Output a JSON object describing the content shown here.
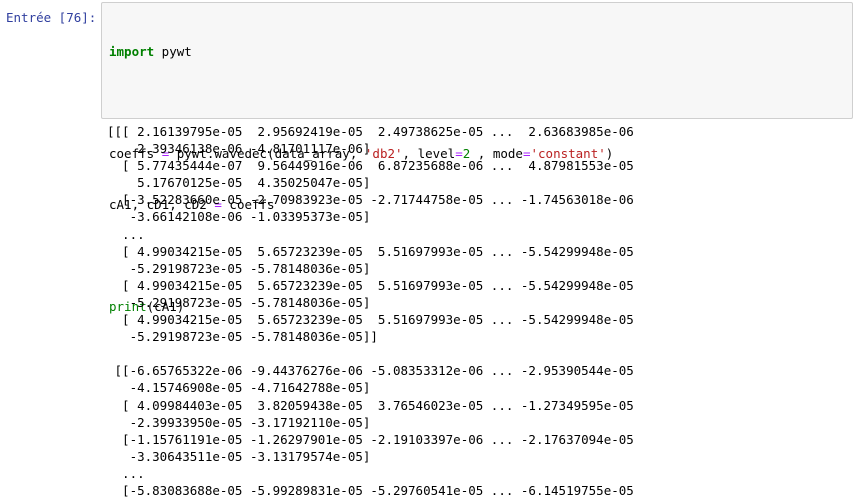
{
  "cell": {
    "prompt": "Entrée [76]:"
  },
  "code": {
    "line1": {
      "kw": "import",
      "rest": " pywt"
    },
    "line3": {
      "a": "coeffs ",
      "eq": "=",
      "b": " pywt.wavedec(data_array, ",
      "s1": "'db2'",
      "c": ", level",
      "eq2": "=",
      "n": "2",
      "d": " , mode",
      "eq3": "=",
      "s2": "'constant'",
      "e": ")"
    },
    "line4": {
      "a": "cA1, cD1, cD2 ",
      "eq": "=",
      "b": " coeffs"
    },
    "line6": {
      "fn": "print",
      "rest": "(cA1)"
    }
  },
  "output_lines": [
    "[[[ 2.16139795e-05  2.95692419e-05  2.49738625e-05 ...  2.63683985e-06",
    "    2.39346138e-06 -4.81701117e-06]",
    "  [ 5.77435444e-07  9.56449916e-06  6.87235688e-06 ...  4.87981553e-05",
    "    5.17670125e-05  4.35025047e-05]",
    "  [-3.52283660e-05 -2.70983923e-05 -2.71744758e-05 ... -1.74563018e-06",
    "   -3.66142108e-06 -1.03395373e-05]",
    "  ...",
    "  [ 4.99034215e-05  5.65723239e-05  5.51697993e-05 ... -5.54299948e-05",
    "   -5.29198723e-05 -5.78148036e-05]",
    "  [ 4.99034215e-05  5.65723239e-05  5.51697993e-05 ... -5.54299948e-05",
    "   -5.29198723e-05 -5.78148036e-05]",
    "  [ 4.99034215e-05  5.65723239e-05  5.51697993e-05 ... -5.54299948e-05",
    "   -5.29198723e-05 -5.78148036e-05]]",
    "",
    " [[-6.65765322e-06 -9.44376276e-06 -5.08353312e-06 ... -2.95390544e-05",
    "   -4.15746908e-05 -4.71642788e-05]",
    "  [ 4.09984403e-05  3.82059438e-05  3.76546023e-05 ... -1.27349595e-05",
    "   -2.39933950e-05 -3.17192110e-05]",
    "  [-1.15761191e-05 -1.26297901e-05 -2.19103397e-06 ... -2.17637094e-05",
    "   -3.30643511e-05 -3.13179574e-05]",
    "  ...",
    "  [-5.83083688e-05 -5.99289831e-05 -5.29760541e-05 ... -6.14519755e-05"
  ]
}
